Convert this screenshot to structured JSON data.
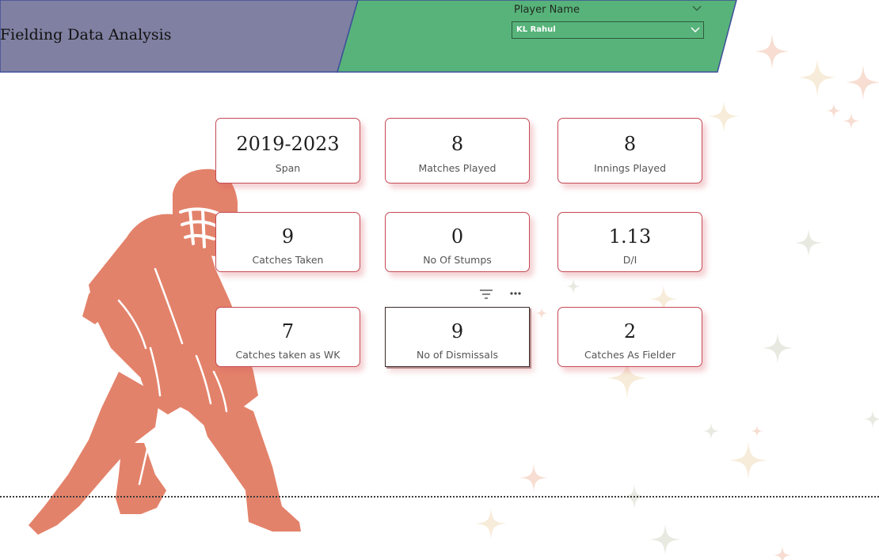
{
  "header": {
    "title": "Fielding Data Analysis",
    "left_panel_color": "#8080a2",
    "right_panel_color": "#57b37a"
  },
  "slicer": {
    "label": "Player Name",
    "selected_value": "KL Rahul",
    "label_icon": "chevron-down-icon",
    "box_icon": "chevron-down-icon"
  },
  "cards": [
    {
      "value": "2019-2023",
      "label": "Span"
    },
    {
      "value": "8",
      "label": "Matches Played"
    },
    {
      "value": "8",
      "label": "Innings Played"
    },
    {
      "value": "9",
      "label": "Catches Taken"
    },
    {
      "value": "0",
      "label": "No Of Stumps"
    },
    {
      "value": "1.13",
      "label": "D/I"
    },
    {
      "value": "7",
      "label": "Catches taken as WK"
    },
    {
      "value": "9",
      "label": "No of Dismissals",
      "selected": true
    },
    {
      "value": "2",
      "label": "Catches As Fielder"
    }
  ],
  "visual_toolbar": {
    "icons": [
      "filter-icon",
      "more-options-icon"
    ]
  },
  "decor": {
    "figure": "wicketkeeper-silhouette",
    "figure_color": "#e3826a",
    "sparkles_color": "#f3d9c4"
  }
}
